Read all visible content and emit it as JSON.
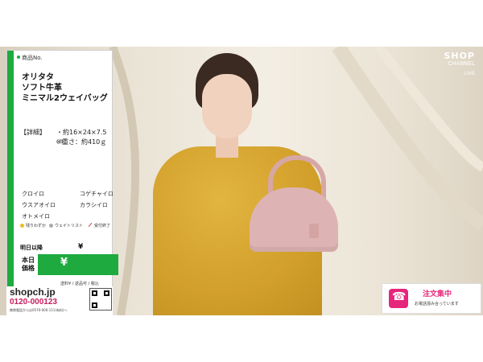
{
  "product": {
    "number_label": "商品No.",
    "title_lines": [
      "オリタタ",
      "ソフト牛革",
      "ミニマル2ウェイバッグ"
    ],
    "spec_label": "【詳細】",
    "spec_size": "・約16×24×7.5㎝",
    "spec_weight": "・重さ：約410ｇ",
    "colors": [
      "クロイロ",
      "コゲチャイロ",
      "ウスアオイロ",
      "カラシイロ",
      "オトメイロ"
    ],
    "legend": [
      {
        "label": "残りわずか",
        "color": "#e8c020"
      },
      {
        "label": "ウェイトリスト",
        "color": "#aaaaaa"
      },
      {
        "label": "受付終了",
        "color": "#d04040"
      }
    ]
  },
  "pricing": {
    "after_tomorrow_label": "明日以降",
    "after_tomorrow_value": "¥",
    "today_label": "本日価格",
    "today_value": "¥",
    "shipping_note": "送料¥  / 返品可 / 税込"
  },
  "footer": {
    "website": "shopch.jp",
    "phone": "0120-000123",
    "phone_alt": "携帯電話からは0570-000-111(有料)へ"
  },
  "brand": {
    "logo_top": "SHOP",
    "logo_mid": "CHANNEL",
    "live": "LIVE"
  },
  "order_badge": {
    "title": "注文集中",
    "subtitle": "お電話混み合っています",
    "icon": "phone-icon",
    "accent": "#e6267a"
  },
  "colors": {
    "green": "#1eaa3f",
    "phone_pink": "#c81c5c"
  }
}
